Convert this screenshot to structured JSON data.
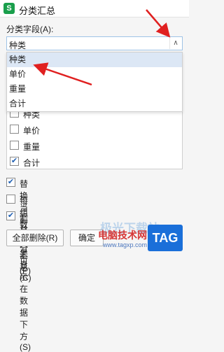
{
  "window": {
    "title": "分类汇总",
    "icon": "S"
  },
  "group_field": {
    "label": "分类字段(A):",
    "value": "种类",
    "options": [
      "种类",
      "单价",
      "重量",
      "合计"
    ],
    "highlighted_option": "种类"
  },
  "summary_items": [
    {
      "label": "种类",
      "checked": false
    },
    {
      "label": "单价",
      "checked": false
    },
    {
      "label": "重量",
      "checked": false
    },
    {
      "label": "合计",
      "checked": true
    }
  ],
  "options": {
    "replace_current": {
      "label": "替换当前分类汇总(C)",
      "checked": true
    },
    "page_break": {
      "label": "每组数据分页(P)",
      "checked": false
    },
    "summary_below": {
      "label": "汇总结果显示在数据下方(S)",
      "checked": true
    }
  },
  "buttons": {
    "remove_all": "全部删除(R)",
    "ok": "确定"
  },
  "watermark": {
    "site": "电脑技术网",
    "url": "www.tagxp.com",
    "badge": "TAG",
    "overlay": "极光下载站"
  },
  "annotation_color": "#e02020"
}
